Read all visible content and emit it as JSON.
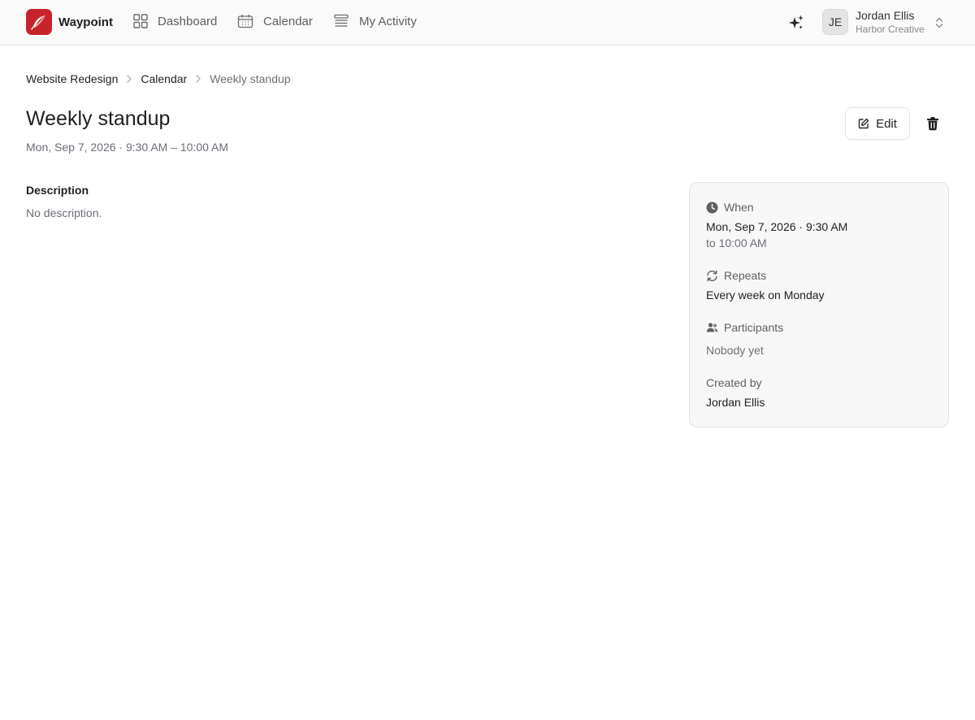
{
  "app": {
    "name": "Waypoint"
  },
  "nav": {
    "dashboard": "Dashboard",
    "calendar": "Calendar",
    "activity": "My Activity"
  },
  "user": {
    "initials": "JE",
    "name": "Jordan Ellis",
    "org": "Harbor Creative"
  },
  "breadcrumb": {
    "items": [
      "Website Redesign",
      "Calendar",
      "Weekly standup"
    ]
  },
  "event": {
    "title": "Weekly standup",
    "subtitle": "Mon, Sep 7, 2026 · 9:30 AM – 10:00 AM",
    "edit_label": "Edit"
  },
  "description": {
    "label": "Description",
    "value": "No description."
  },
  "details": {
    "when_label": "When",
    "when_start": "Mon, Sep 7, 2026 · 9:30 AM",
    "when_end": "to 10:00 AM",
    "repeats_label": "Repeats",
    "repeats_value": "Every week on Monday",
    "participants_label": "Participants",
    "participants_value": "Nobody yet",
    "created_label": "Created by",
    "created_value": "Jordan Ellis"
  },
  "colors": {
    "brand": "#c8232b",
    "card_bg": "#f7f7f7"
  }
}
